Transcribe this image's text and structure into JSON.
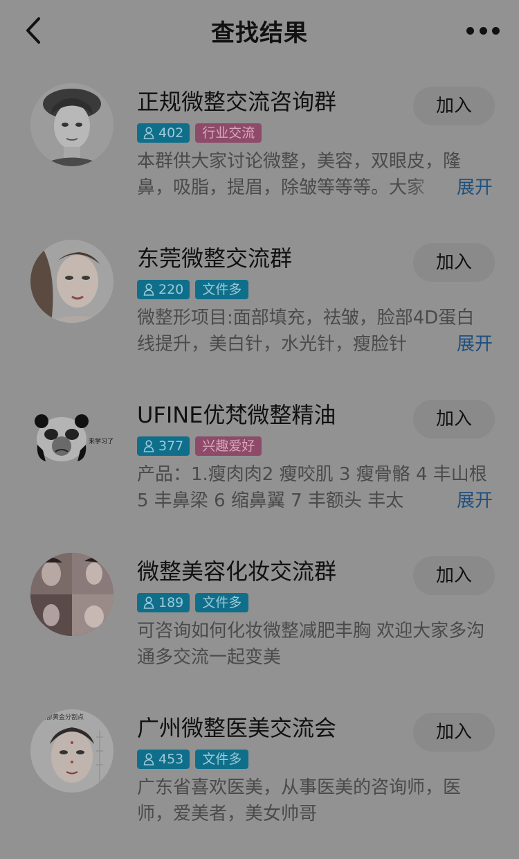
{
  "header": {
    "title": "查找结果",
    "back_icon": "chevron-left-icon",
    "more_icon": "more-horizontal-icon"
  },
  "groups": [
    {
      "name": "正规微整交流咨询群",
      "members": "402",
      "category": "行业交流",
      "category_color": "pink",
      "description": "本群供大家讨论微整，美容，双眼皮，隆鼻，吸脂，提眉，除皱等等等。大家",
      "join_label": "加入",
      "expand_label": "展开"
    },
    {
      "name": "东莞微整交流群",
      "members": "220",
      "category": "文件多",
      "category_color": "teal",
      "description": "微整形项目:面部填充，祛皱，脸部4D蛋白线提升，美白针，水光针，瘦脸针",
      "join_label": "加入",
      "expand_label": "展开"
    },
    {
      "name": "UFINE优梵微整精油",
      "members": "377",
      "category": "兴趣爱好",
      "category_color": "pink",
      "description": "产品：1.瘦肉肉2 瘦咬肌 3 瘦骨骼 4 丰山根 5 丰鼻梁 6 缩鼻翼 7 丰额头 丰太",
      "join_label": "加入",
      "expand_label": "展开"
    },
    {
      "name": "微整美容化妆交流群",
      "members": "189",
      "category": "文件多",
      "category_color": "teal",
      "description": "可咨询如何化妆微整减肥丰胸 欢迎大家多沟通多交流一起变美",
      "join_label": "加入"
    },
    {
      "name": "广州微整医美交流会",
      "members": "453",
      "category": "文件多",
      "category_color": "teal",
      "description": "广东省喜欢医美，从事医美的咨询师，医师，爱美者，美女帅哥",
      "join_label": "加入"
    }
  ],
  "avatars": {
    "panda_sticker_text": "来学习了!",
    "face_chart_title": "面部黄金分割点"
  },
  "colors": {
    "background": "#929292",
    "member_tag": "#0f6f8b",
    "pink_tag": "#8e4b69",
    "expand_link": "#1f4f7f"
  }
}
